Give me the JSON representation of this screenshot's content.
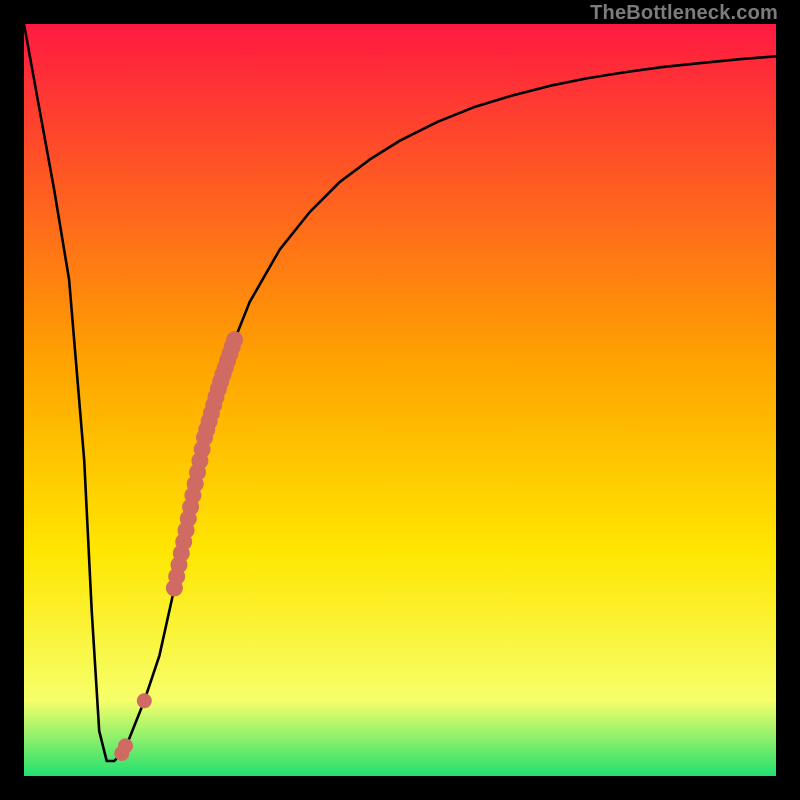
{
  "watermark": "TheBottleneck.com",
  "colors": {
    "frame": "#000000",
    "gradient_top": "#ff1a41",
    "gradient_mid1": "#ffa300",
    "gradient_mid2": "#ffe600",
    "gradient_mid3": "#f6ff6a",
    "gradient_bottom": "#22e06e",
    "curve": "#000000",
    "marker_fill": "#cf6b63",
    "marker_stroke": "#cf6b63"
  },
  "chart_data": {
    "type": "line",
    "title": "",
    "xlabel": "",
    "ylabel": "",
    "xlim": [
      0,
      100
    ],
    "ylim": [
      0,
      100
    ],
    "series": [
      {
        "name": "bottleneck-curve",
        "x": [
          0,
          2,
          4,
          6,
          8,
          9,
          10,
          11,
          12,
          13,
          14,
          16,
          18,
          20,
          22,
          24,
          26,
          28,
          30,
          34,
          38,
          42,
          46,
          50,
          55,
          60,
          65,
          70,
          75,
          80,
          85,
          90,
          95,
          100
        ],
        "y": [
          100,
          89,
          78,
          66,
          42,
          22,
          6,
          2,
          2,
          3,
          5,
          10,
          16,
          25,
          35,
          45,
          52,
          58,
          63,
          70,
          75,
          79,
          82,
          84.5,
          87,
          89,
          90.5,
          91.8,
          92.8,
          93.6,
          94.3,
          94.8,
          95.3,
          95.7
        ]
      }
    ],
    "markers": [
      {
        "name": "highlight-band",
        "x": [
          20,
          28
        ],
        "y": [
          25,
          58
        ]
      },
      {
        "name": "point-a",
        "x": 16,
        "y": 10
      },
      {
        "name": "point-b",
        "x": 13.5,
        "y": 4
      },
      {
        "name": "point-c",
        "x": 13,
        "y": 3
      }
    ]
  }
}
